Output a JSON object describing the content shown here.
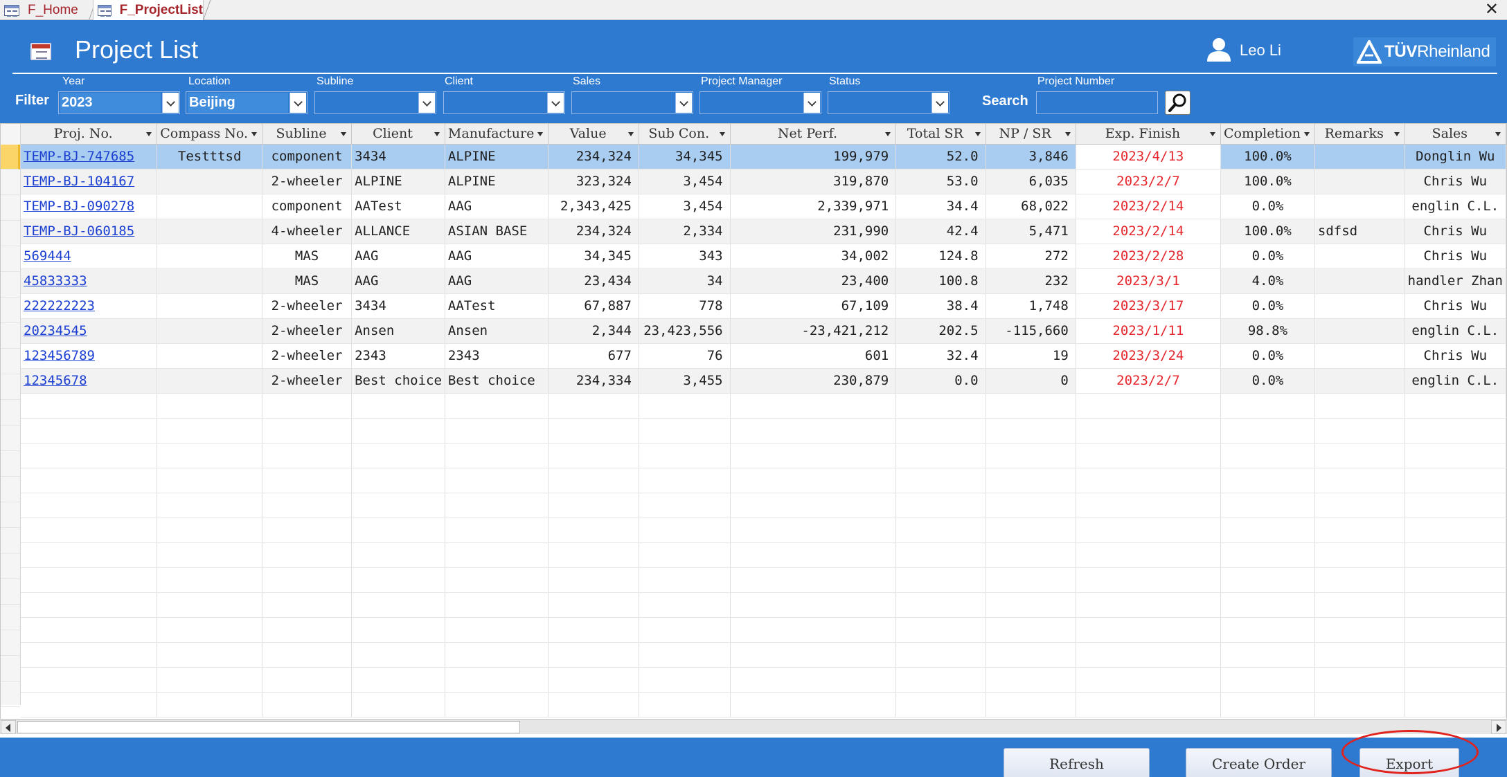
{
  "tabs": [
    {
      "label": "F_Home",
      "active": false
    },
    {
      "label": "F_ProjectList",
      "active": true
    }
  ],
  "window": {
    "close_glyph": "✕"
  },
  "header": {
    "title": "Project List",
    "user_name": "Leo Li",
    "logo_text_bold": "TÜV",
    "logo_text": "Rheinland",
    "icons": {
      "form": "form-icon",
      "user": "user-icon",
      "search": "magnifier-icon",
      "logo": "tuv-logo-icon"
    }
  },
  "filter": {
    "label": "Filter",
    "fields": [
      {
        "label": "Year",
        "value": "2023"
      },
      {
        "label": "Location",
        "value": "Beijing"
      },
      {
        "label": "Subline",
        "value": ""
      },
      {
        "label": "Client",
        "value": ""
      },
      {
        "label": "Sales",
        "value": ""
      },
      {
        "label": "Project Manager",
        "value": ""
      },
      {
        "label": "Status",
        "value": ""
      }
    ],
    "search_label": "Search",
    "project_number_label": "Project Number",
    "project_number_value": ""
  },
  "grid": {
    "columns": [
      "Proj. No.",
      "Compass No.",
      "Subline",
      "Client",
      "Manufacture",
      "Value",
      "Sub Con.",
      "Net Perf.",
      "Total SR",
      "NP / SR",
      "Exp. Finish",
      "Completion",
      "Remarks",
      "Sales"
    ],
    "rows": [
      [
        "TEMP-BJ-747685",
        "Testttsd",
        "component",
        "3434",
        "ALPINE",
        "234,324",
        "34,345",
        "199,979",
        "52.0",
        "3,846",
        "2023/4/13",
        "100.0%",
        "",
        "Donglin Wu"
      ],
      [
        "TEMP-BJ-104167",
        "",
        "2-wheeler",
        "ALPINE",
        "ALPINE",
        "323,324",
        "3,454",
        "319,870",
        "53.0",
        "6,035",
        "2023/2/7",
        "100.0%",
        "",
        "Chris Wu"
      ],
      [
        "TEMP-BJ-090278",
        "",
        "component",
        "AATest",
        "AAG",
        "2,343,425",
        "3,454",
        "2,339,971",
        "34.4",
        "68,022",
        "2023/2/14",
        "0.0%",
        "",
        "englin C.L."
      ],
      [
        "TEMP-BJ-060185",
        "",
        "4-wheeler",
        "ALLANCE",
        "ASIAN BASE",
        "234,324",
        "2,334",
        "231,990",
        "42.4",
        "5,471",
        "2023/2/14",
        "100.0%",
        "sdfsd",
        "Chris Wu"
      ],
      [
        "569444",
        "",
        "MAS",
        "AAG",
        "AAG",
        "34,345",
        "343",
        "34,002",
        "124.8",
        "272",
        "2023/2/28",
        "0.0%",
        "",
        "Chris Wu"
      ],
      [
        "45833333",
        "",
        "MAS",
        "AAG",
        "AAG",
        "23,434",
        "34",
        "23,400",
        "100.8",
        "232",
        "2023/3/1",
        "4.0%",
        "",
        "handler Zhan"
      ],
      [
        "222222223",
        "",
        "2-wheeler",
        "3434",
        "AATest",
        "67,887",
        "778",
        "67,109",
        "38.4",
        "1,748",
        "2023/3/17",
        "0.0%",
        "",
        "Chris Wu"
      ],
      [
        "20234545",
        "",
        "2-wheeler",
        "Ansen",
        "Ansen",
        "2,344",
        "23,423,556",
        "-23,421,212",
        "202.5",
        "-115,660",
        "2023/1/11",
        "98.8%",
        "",
        "englin C.L."
      ],
      [
        "123456789",
        "",
        "2-wheeler",
        "2343",
        "2343",
        "677",
        "76",
        "601",
        "32.4",
        "19",
        "2023/3/24",
        "0.0%",
        "",
        "Chris Wu"
      ],
      [
        "12345678",
        "",
        "2-wheeler",
        "Best choice",
        "Best choice",
        "234,334",
        "3,455",
        "230,879",
        "0.0",
        "0",
        "2023/2/7",
        "0.0%",
        "",
        "englin C.L."
      ]
    ],
    "selected_row": 0
  },
  "footer": {
    "refresh_label": "Refresh",
    "create_order_label": "Create Order",
    "export_label": "Export"
  },
  "colors": {
    "header_bg": "#2f7ad1",
    "selected_row": "#a9cdf0",
    "date_text": "#e5262d",
    "link_text": "#1b3fd1",
    "annotation_circle": "#e0231d"
  }
}
